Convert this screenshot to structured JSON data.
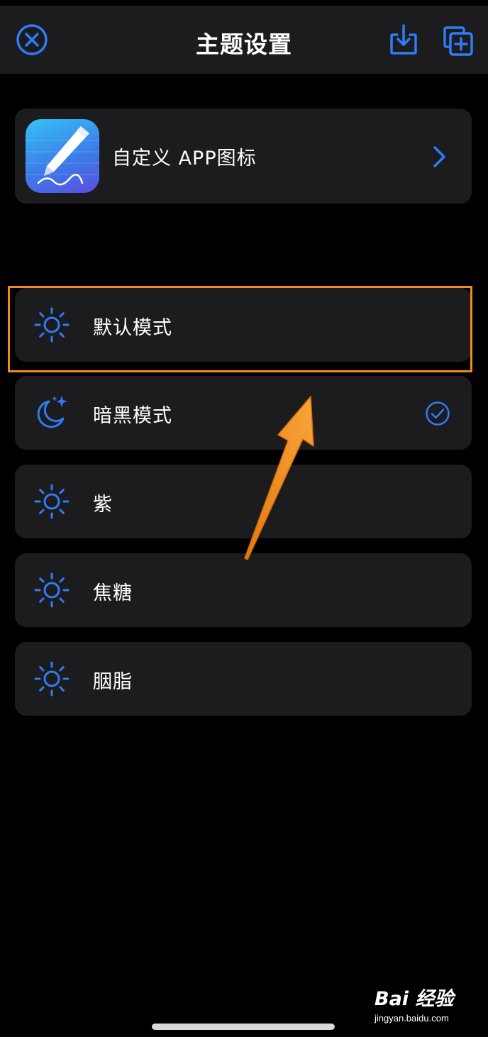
{
  "header": {
    "title": "主题设置",
    "close_icon": "close-circle-icon",
    "download_icon": "download-tray-icon",
    "add_icon": "add-copy-icon"
  },
  "app_icon_card": {
    "label": "自定义 APP图标",
    "icon": "pen-app-icon",
    "chevron": "chevron-right-icon"
  },
  "themes": [
    {
      "label": "默认模式",
      "icon": "sun-icon",
      "selected": false
    },
    {
      "label": "暗黑模式",
      "icon": "moon-stars-icon",
      "selected": true
    },
    {
      "label": "紫",
      "icon": "sun-icon",
      "selected": false
    },
    {
      "label": "焦糖",
      "icon": "sun-icon",
      "selected": false
    },
    {
      "label": "胭脂",
      "icon": "sun-icon",
      "selected": false
    }
  ],
  "colors": {
    "accent": "#2f7cf6",
    "card_bg": "#1c1c1e",
    "background": "#000000",
    "annotation": "#f28a1f"
  },
  "watermark": {
    "brand": "Bai 经验",
    "site": "jingyan.baidu.com"
  }
}
